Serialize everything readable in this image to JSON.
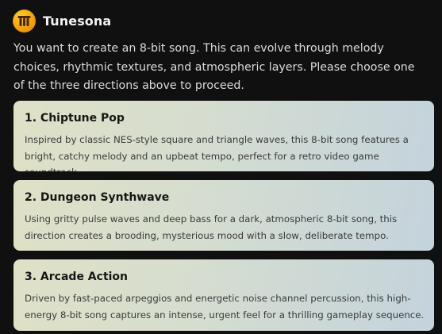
{
  "header": {
    "app_name": "Tunesona",
    "logo_icon": "tunesona-logo-icon",
    "logo_color": "#F5A712"
  },
  "message": {
    "intro": "You want to create an 8-bit song. This can evolve through melody choices, rhythmic textures, and atmospheric layers. Please choose one of the three directions above to proceed."
  },
  "options": [
    {
      "title": "1. Chiptune Pop",
      "description": "Inspired by classic NES-style square and triangle waves, this 8-bit song features a bright, catchy melody and an upbeat tempo, perfect for a retro video game soundtrack."
    },
    {
      "title": "2. Dungeon Synthwave",
      "description": "Using gritty pulse waves and deep bass for a dark, atmospheric 8-bit song, this direction creates a brooding, mysterious mood with a slow, deliberate tempo."
    },
    {
      "title": "3. Arcade Action",
      "description": "Driven by fast-paced arpeggios and energetic noise channel percussion, this high-energy 8-bit song captures an intense, urgent feel for a thrilling gameplay sequence."
    }
  ]
}
